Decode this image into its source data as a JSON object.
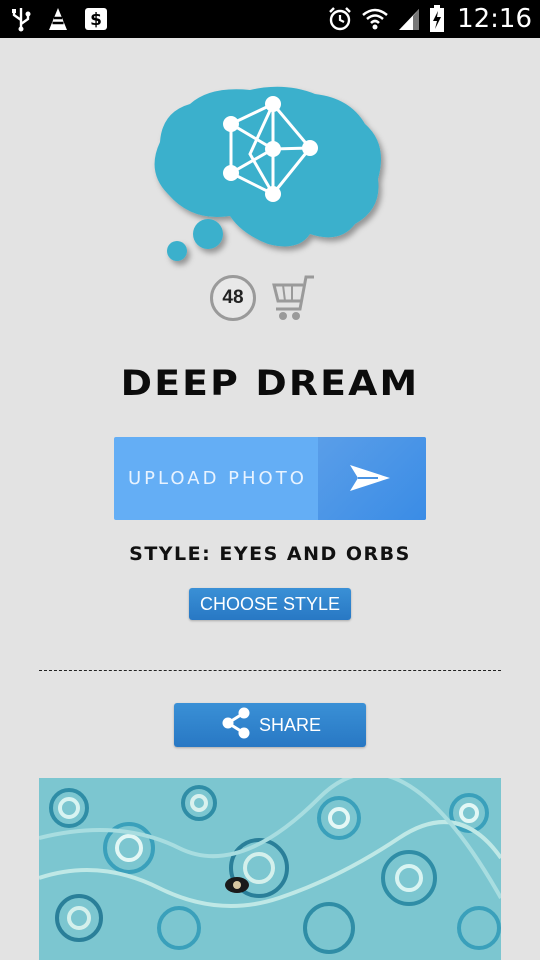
{
  "status_bar": {
    "time": "12:16",
    "icons": [
      "usb-icon",
      "vlc-cone-icon",
      "dollar-app-icon",
      "alarm-icon",
      "wifi-icon",
      "signal-icon",
      "battery-charging-icon"
    ]
  },
  "logo": {
    "icon": "brain-network-icon"
  },
  "counter": {
    "value": "48"
  },
  "cart": {
    "icon": "cart-icon"
  },
  "title": "DEEP DREAM",
  "upload": {
    "label": "UPLOAD PHOTO",
    "icon": "send-arrow-icon"
  },
  "style": {
    "text": "STYLE: EYES AND ORBS"
  },
  "choose_style": {
    "label": "CHOOSE STYLE"
  },
  "share": {
    "label": "SHARE",
    "icon": "share-icon"
  },
  "colors": {
    "brain": "#3bb0cc",
    "upload_bg": "#64aef5",
    "button_blue": "#2f84cc",
    "background": "#e3e3e3"
  }
}
